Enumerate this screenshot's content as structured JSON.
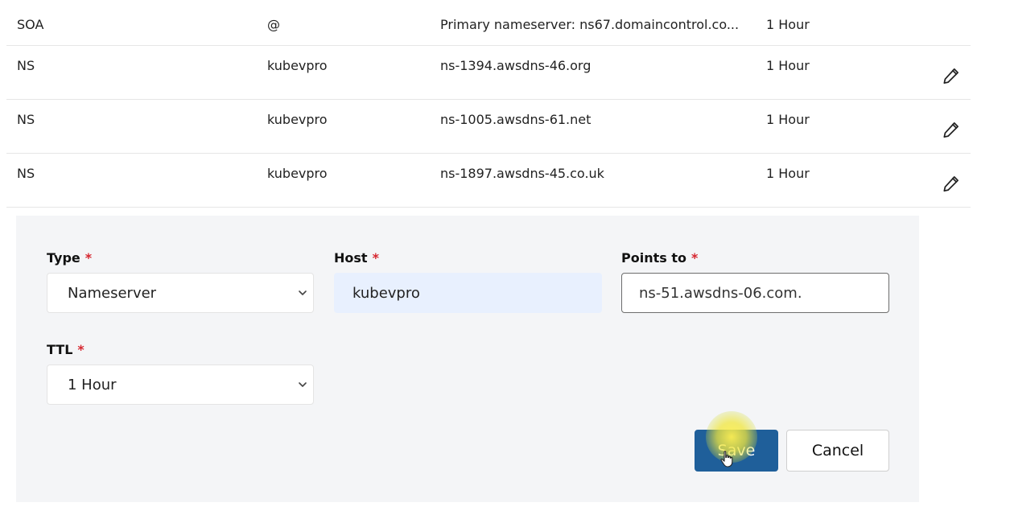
{
  "records": [
    {
      "type": "SOA",
      "host": "@",
      "value": "Primary nameserver: ns67.domaincontrol.co...",
      "ttl": "1 Hour",
      "editable": false
    },
    {
      "type": "NS",
      "host": "kubevpro",
      "value": "ns-1394.awsdns-46.org",
      "ttl": "1 Hour",
      "editable": true
    },
    {
      "type": "NS",
      "host": "kubevpro",
      "value": "ns-1005.awsdns-61.net",
      "ttl": "1 Hour",
      "editable": true
    },
    {
      "type": "NS",
      "host": "kubevpro",
      "value": "ns-1897.awsdns-45.co.uk",
      "ttl": "1 Hour",
      "editable": true
    }
  ],
  "icons": {
    "edit": "pencil-icon",
    "dropdown": "chevron-down-icon",
    "cursor": "hand-pointer-icon"
  },
  "form": {
    "type_label": "Type",
    "type_value": "Nameserver",
    "host_label": "Host",
    "host_value": "kubevpro",
    "points_to_label": "Points to",
    "points_to_value": "ns-51.awsdns-06.com.",
    "ttl_label": "TTL",
    "ttl_value": "1 Hour",
    "required_mark": "*",
    "save_label": "Save",
    "cancel_label": "Cancel"
  },
  "colors": {
    "primary_button": "#1f5f9a",
    "required": "#d6262f",
    "panel_bg": "#f4f5f7",
    "autofill_bg": "#e8f0fe"
  }
}
